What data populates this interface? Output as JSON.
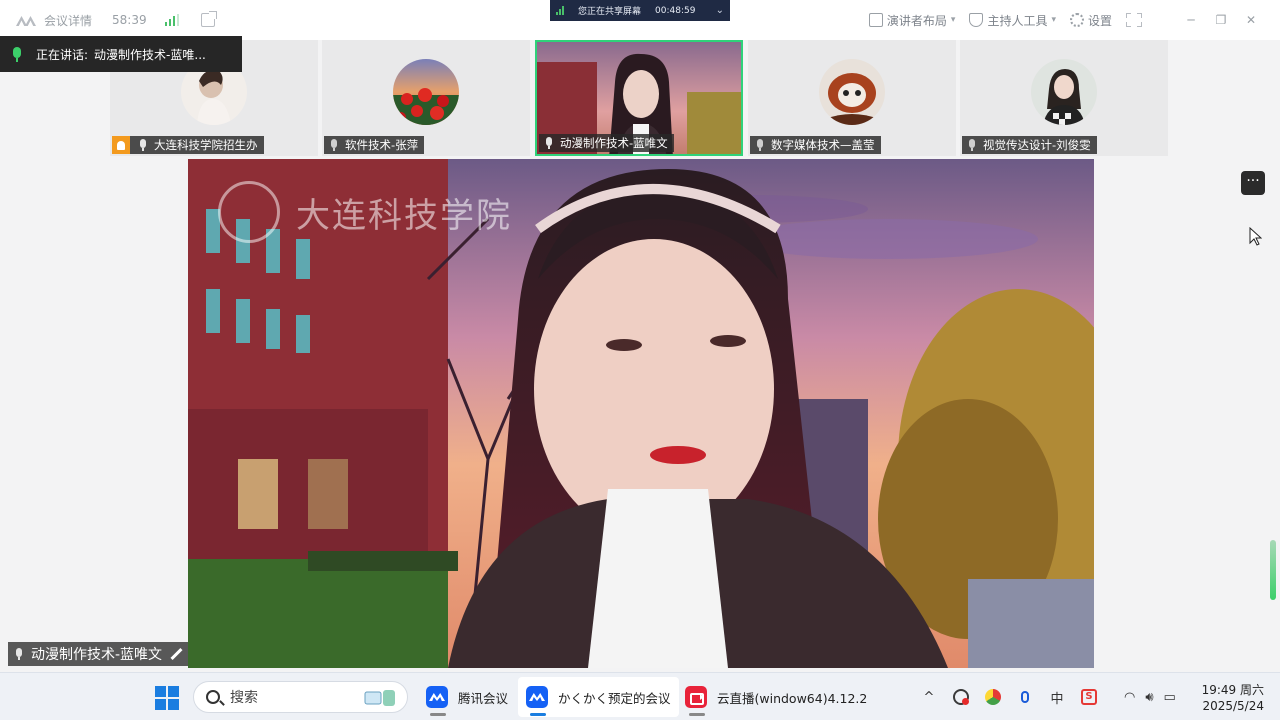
{
  "topbar": {
    "meeting_details_label": "会议详情",
    "timer": "58:39",
    "right_items": [
      {
        "label": "演讲者布局",
        "icon": "layout-icon",
        "has_caret": true
      },
      {
        "label": "主持人工具",
        "icon": "shield-icon",
        "has_caret": true
      },
      {
        "label": "设置",
        "icon": "gear-icon",
        "has_caret": false
      }
    ],
    "window_controls": [
      "─",
      "❐",
      "✕"
    ]
  },
  "share_banner": {
    "text": "您正在共享屏幕",
    "duration": "00:48:59",
    "chevron": "⌄"
  },
  "speaking": {
    "label": "正在讲话:",
    "name": "动漫制作技术-蓝唯..."
  },
  "participants": [
    {
      "name": "大连科技学院招生办",
      "host": true,
      "active": false,
      "avatar": "avatar-host"
    },
    {
      "name": "软件技术-张萍",
      "host": false,
      "active": false,
      "avatar": "avatar-flowers"
    },
    {
      "name": "动漫制作技术-蓝唯文",
      "host": false,
      "active": true,
      "avatar": "avatar-video"
    },
    {
      "name": "数字媒体技术—盖莹",
      "host": false,
      "active": false,
      "avatar": "avatar-redpanda"
    },
    {
      "name": "视觉传达设计-刘俊雯",
      "host": false,
      "active": false,
      "avatar": "avatar-girl"
    }
  ],
  "main_video": {
    "watermark": "大连科技学院",
    "speaker_name": "动漫制作技术-蓝唯文"
  },
  "more_button": "···",
  "taskbar": {
    "search_placeholder": "搜索",
    "apps": [
      {
        "label": "腾讯会议",
        "icon": "tencent-meeting-icon",
        "active": false
      },
      {
        "label": "かくかく预定的会议",
        "icon": "tencent-meeting-icon",
        "active": true
      },
      {
        "label": "云直播(window64)4.12.2",
        "icon": "cloud-live-icon",
        "active": false
      }
    ],
    "tray_caret": "^",
    "time": "19:49 周六",
    "date": "2025/5/24"
  },
  "colors": {
    "accent_green": "#2fd27a",
    "host_orange": "#f39a1e",
    "windows_blue": "#1a7de0"
  }
}
